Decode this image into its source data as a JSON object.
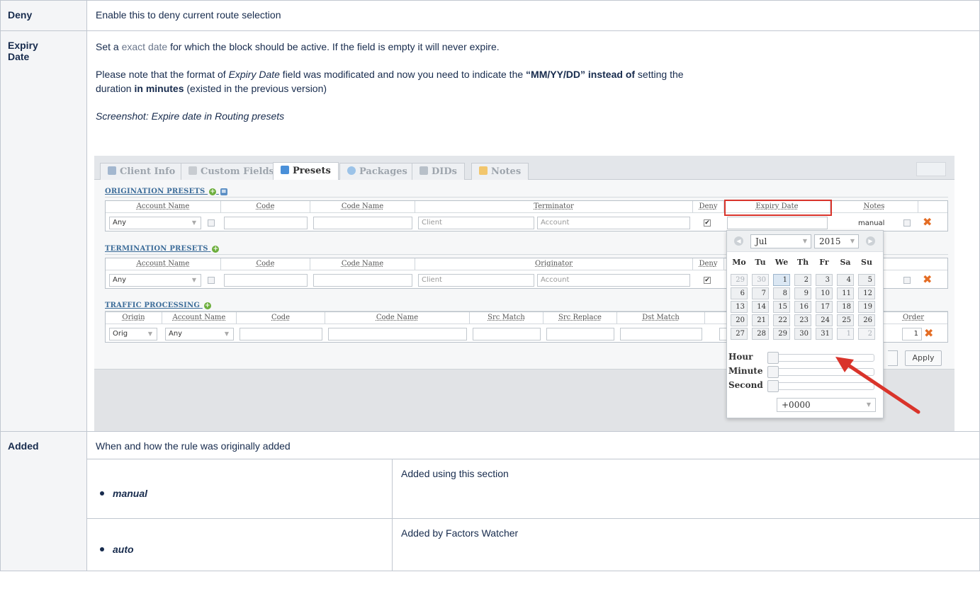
{
  "deny": {
    "label": "Deny",
    "description": "Enable this to deny current route selection"
  },
  "expiry": {
    "label_line1": "Expiry",
    "label_line2": "Date",
    "p1_before": "Set a ",
    "p1_link": "exact date",
    "p1_after": " for which the block should be active. If the field is empty it will never expire.",
    "p2_a": "Please note that the format of ",
    "p2_italic": "Expiry Date",
    "p2_b": " field was modificated and now you need to indicate the ",
    "p2_bold1": "“MM/YY/DD” instead of",
    "p2_c": " setting the",
    "p2_d": "duration ",
    "p2_bold2": "in minutes",
    "p2_e": " (existed in the previous version)",
    "caption": "Screenshot: Expire date in Routing presets"
  },
  "screenshot": {
    "tabs": [
      {
        "label": "Client Info",
        "icon_color": "#a3b7cf",
        "active": false
      },
      {
        "label": "Custom Fields",
        "icon_color": "#c8ccd1",
        "active": false
      },
      {
        "label": "Presets",
        "icon_color": "#4a90d9",
        "active": true
      },
      {
        "label": "Packages",
        "icon_color": "#9cc3e8",
        "active": false
      },
      {
        "label": "DIDs",
        "icon_color": "#b8c0c9",
        "active": false
      },
      {
        "label": "Notes",
        "icon_color": "#f2c66d",
        "active": false
      }
    ],
    "origination": {
      "title": "ORIGINATION PRESETS",
      "headers": [
        "Account Name",
        "Code",
        "Code Name",
        "Terminator",
        "Deny",
        "Expiry Date",
        "Notes"
      ],
      "account_value": "Any",
      "client_placeholder": "Client",
      "account_placeholder": "Account",
      "notes_value": "manual"
    },
    "termination": {
      "title": "TERMINATION PRESETS",
      "headers": [
        "Account Name",
        "Code",
        "Code Name",
        "Originator",
        "Deny"
      ],
      "account_value": "Any",
      "client_placeholder": "Client",
      "account_placeholder": "Account"
    },
    "traffic": {
      "title": "TRAFFIC PROCESSING",
      "headers": [
        "Origin",
        "Account Name",
        "Code",
        "Code Name",
        "Src Match",
        "Src Replace",
        "Dst Match",
        "Order"
      ],
      "origin_value": "Orig",
      "account_value": "Any",
      "order_value": "1"
    },
    "apply_label": "Apply",
    "calendar": {
      "month": "Jul",
      "year": "2015",
      "dow": [
        "Mo",
        "Tu",
        "We",
        "Th",
        "Fr",
        "Sa",
        "Su"
      ],
      "weeks": [
        [
          "29",
          "30",
          "1",
          "2",
          "3",
          "4",
          "5"
        ],
        [
          "6",
          "7",
          "8",
          "9",
          "10",
          "11",
          "12"
        ],
        [
          "13",
          "14",
          "15",
          "16",
          "17",
          "18",
          "19"
        ],
        [
          "20",
          "21",
          "22",
          "23",
          "24",
          "25",
          "26"
        ],
        [
          "27",
          "28",
          "29",
          "30",
          "31",
          "1",
          "2"
        ]
      ],
      "hour_label": "Hour",
      "minute_label": "Minute",
      "second_label": "Second",
      "timezone": "+0000"
    }
  },
  "added": {
    "label": "Added",
    "description": "When and how the rule was originally added",
    "items": [
      {
        "name": "manual",
        "desc": "Added using this section"
      },
      {
        "name": "auto",
        "desc": "Added by Factors Watcher"
      }
    ]
  }
}
